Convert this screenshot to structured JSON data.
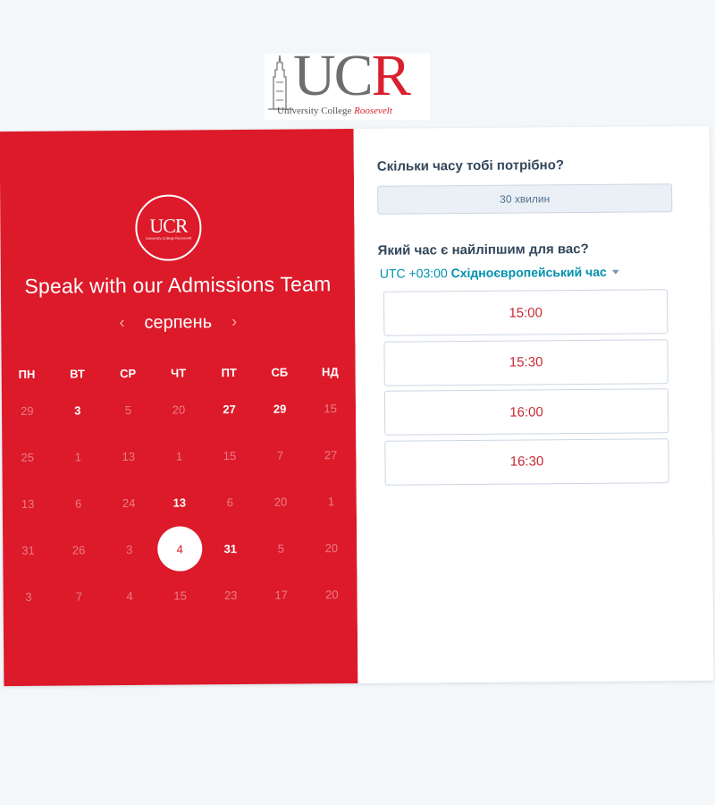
{
  "logo": {
    "word_gray": "UC",
    "word_red": "R",
    "subtitle": "University College",
    "subtitle_red": "Roosevelt"
  },
  "card": {
    "avatar": {
      "word": "UCR",
      "sub": "University College Roosevelt"
    },
    "headline": "Speak with our Admissions Team",
    "month": "серпень",
    "weekdays": [
      "ПН",
      "ВТ",
      "СР",
      "ЧТ",
      "ПТ",
      "СБ",
      "НД"
    ],
    "weeks": [
      [
        "29",
        "3",
        "5",
        "20",
        "27",
        "29",
        "15"
      ],
      [
        "25",
        "1",
        "13",
        "1",
        "15",
        "7",
        "27"
      ],
      [
        "13",
        "6",
        "24",
        "13",
        "6",
        "20",
        "1"
      ],
      [
        "31",
        "26",
        "3",
        "4",
        "31",
        "5",
        "20"
      ],
      [
        "3",
        "7",
        "4",
        "15",
        "23",
        "17",
        "20"
      ]
    ],
    "available": [
      [
        0,
        1
      ],
      [
        0,
        4
      ],
      [
        0,
        5
      ],
      [
        2,
        3
      ],
      [
        3,
        4
      ]
    ],
    "selected": [
      3,
      3
    ]
  },
  "duration": {
    "label": "Скільки часу тобі потрібно?",
    "value": "30 хвилин"
  },
  "time": {
    "label": "Який час є найліпшим для вас?",
    "tz_offset": "UTC +03:00",
    "tz_name": "Східноєвропейський час",
    "slots": [
      "15:00",
      "15:30",
      "16:00",
      "16:30"
    ]
  },
  "colors": {
    "brand_red": "#dc1a2a",
    "slot_text": "#c62a35",
    "accent_teal": "#0091ae"
  }
}
